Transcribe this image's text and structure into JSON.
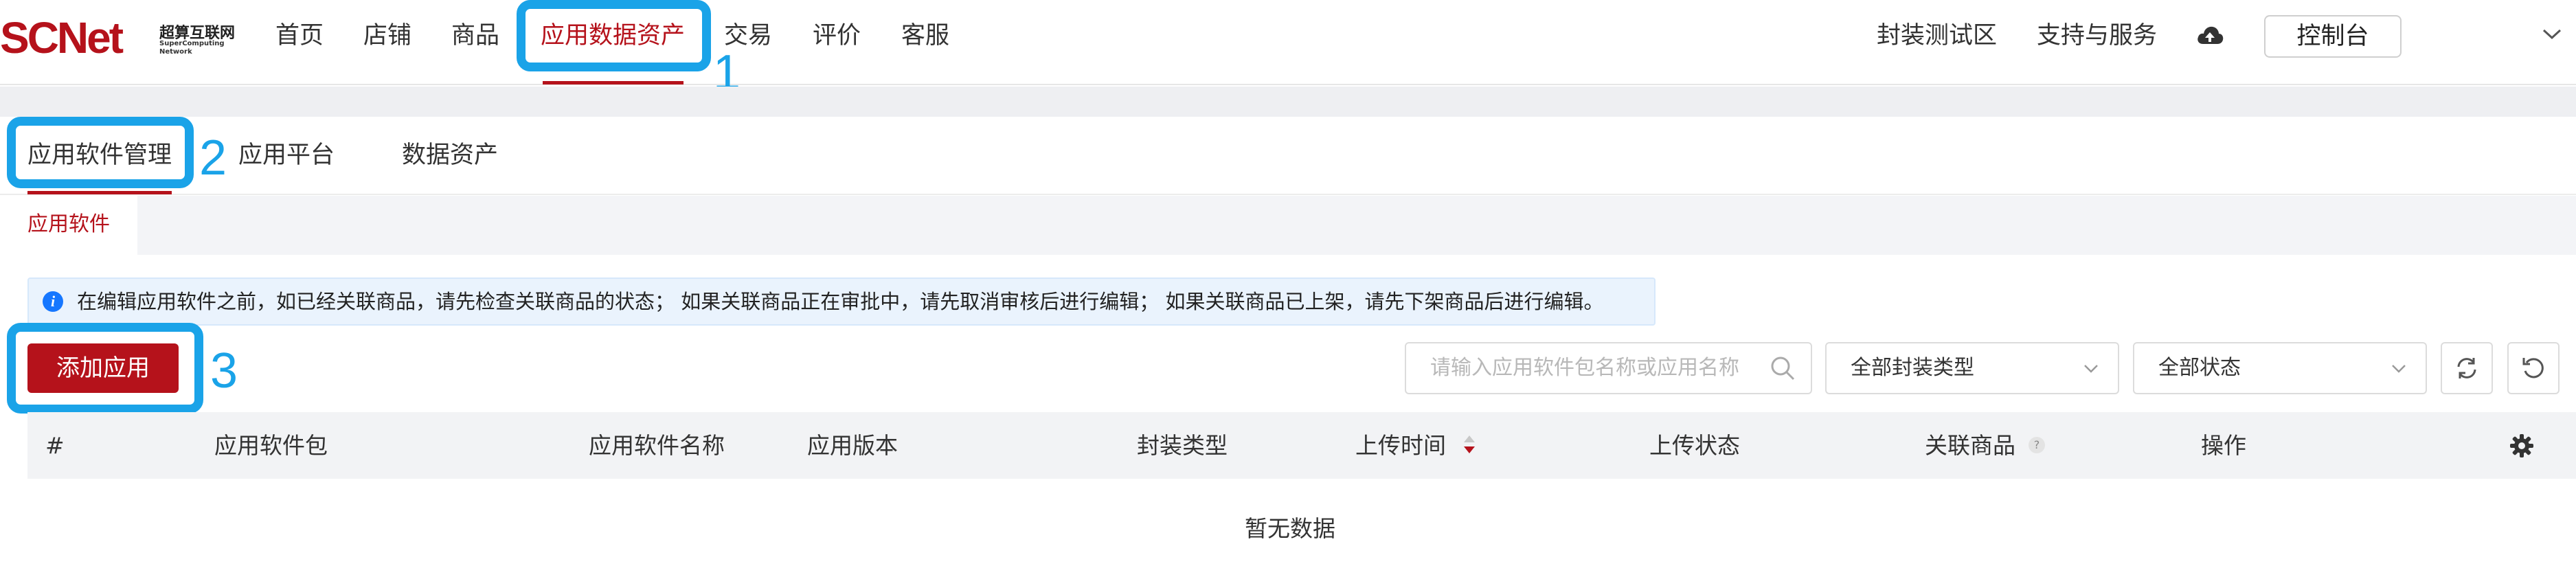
{
  "brand": {
    "logo_text": "SCNet",
    "cn_name": "超算互联网",
    "en_name": "SuperComputing Network",
    "accent": "#b5121b",
    "highlight": "#1aa3e8"
  },
  "topnav": {
    "items": [
      "首页",
      "店铺",
      "商品",
      "应用数据资产",
      "交易",
      "评价",
      "客服"
    ],
    "active_index": 3,
    "right_links": [
      "封装测试区",
      "支持与服务"
    ],
    "console_label": "控制台",
    "icons": [
      "cloud-upload-icon",
      "chevron-down-icon"
    ]
  },
  "annotations": [
    "1",
    "2",
    "3"
  ],
  "tabs": [
    "应用软件管理",
    "应用平台",
    "数据资产"
  ],
  "subtab": "应用软件",
  "notice": {
    "icon": "info-icon",
    "text": "在编辑应用软件之前，如已经关联商品，请先检查关联商品的状态；  如果关联商品正在审批中，请先取消审核后进行编辑；  如果关联商品已上架，请先下架商品后进行编辑。"
  },
  "toolbar": {
    "add_label": "添加应用",
    "search_placeholder": "请输入应用软件包名称或应用名称",
    "type_select": "全部封装类型",
    "status_select": "全部状态",
    "icons": [
      "search-icon",
      "refresh-icon",
      "reset-icon"
    ]
  },
  "table": {
    "columns": [
      "#",
      "应用软件包",
      "应用软件名称",
      "应用版本",
      "封装类型",
      "上传时间",
      "上传状态",
      "关联商品",
      "操作"
    ],
    "help_mark": "?",
    "empty_text": "暂无数据",
    "icons": [
      "sort-icon",
      "settings-gear-icon"
    ]
  }
}
